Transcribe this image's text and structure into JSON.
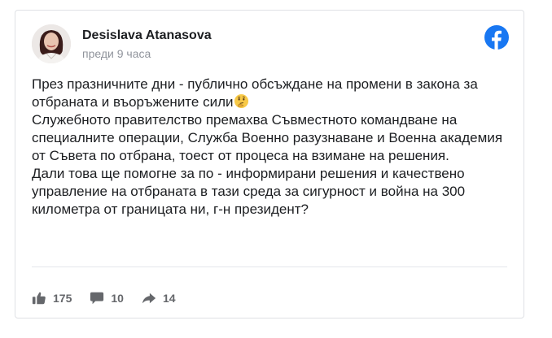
{
  "post": {
    "author": "Desislava Atanasova",
    "timestamp": "преди 9 часа",
    "paragraphs": [
      "През празничните дни - публично обсъждане на промени в закона за отбраната и въоръжените сили",
      "Служебното правителство премахва Съвместното командване на специалните операции, Служба Военно разузнаване и Военна академия от Съвета по отбрана, тоест от процеса на взимане на решения.",
      "Дали това ще помогне за по - информирани решения и качествено управление на отбраната в тази среда за сигурност и война на 300 километра от границата ни, г-н президент?"
    ],
    "emoji": "thinking-face"
  },
  "actions": {
    "likes": "175",
    "comments": "10",
    "shares": "14"
  },
  "colors": {
    "facebook_blue": "#1877f2",
    "icon_gray": "#65676b"
  }
}
